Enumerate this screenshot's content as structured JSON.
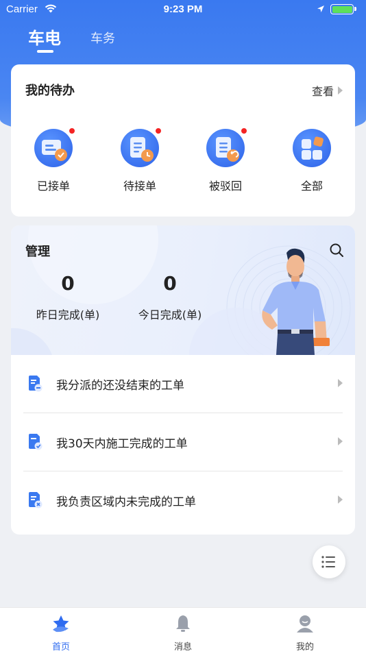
{
  "status_bar": {
    "carrier": "Carrier",
    "time": "9:23 PM"
  },
  "top_tabs": {
    "active": "车电",
    "inactive": "车务"
  },
  "todo": {
    "title": "我的待办",
    "view_label": "查看",
    "items": [
      {
        "label": "已接单",
        "icon": "accepted-order-icon",
        "badge": true
      },
      {
        "label": "待接单",
        "icon": "pending-order-icon",
        "badge": true
      },
      {
        "label": "被驳回",
        "icon": "rejected-order-icon",
        "badge": true
      },
      {
        "label": "全部",
        "icon": "all-orders-icon",
        "badge": false
      }
    ]
  },
  "management": {
    "title": "管理",
    "stats": [
      {
        "value": "0",
        "label": "昨日完成(单)"
      },
      {
        "value": "0",
        "label": "今日完成(单)"
      }
    ],
    "list": [
      {
        "label": "我分派的还没结束的工单",
        "icon": "document-minus-icon"
      },
      {
        "label": "我30天内施工完成的工单",
        "icon": "document-check-icon"
      },
      {
        "label": "我负责区域内未完成的工单",
        "icon": "document-x-icon"
      }
    ]
  },
  "tabbar": {
    "items": [
      {
        "label": "首页",
        "active": true
      },
      {
        "label": "消息",
        "active": false
      },
      {
        "label": "我的",
        "active": false
      }
    ]
  },
  "colors": {
    "primary": "#2f6cf0",
    "header_top": "#3a79f0",
    "badge_red": "#f42424",
    "accent_orange": "#f39a4e"
  }
}
